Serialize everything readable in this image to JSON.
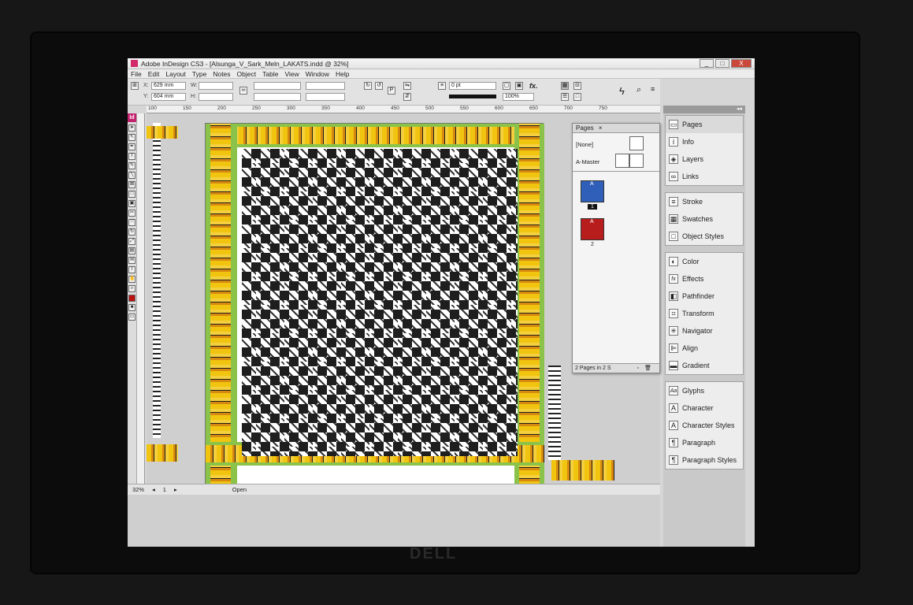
{
  "window": {
    "title": "Adobe InDesign CS3 - [Alsunga_V_Sark_Meln_LAKATS.indd @ 32%]",
    "app_icon_label": "Id",
    "min_label": "_",
    "max_label": "□",
    "close_label": "X"
  },
  "menu": [
    "File",
    "Edit",
    "Layout",
    "Type",
    "Notes",
    "Object",
    "Table",
    "View",
    "Window",
    "Help"
  ],
  "control_bar": {
    "x_label": "X:",
    "x_value": "629 mm",
    "y_label": "Y:",
    "y_value": "604 mm",
    "w_label": "W:",
    "h_label": "H:",
    "stroke_weight": "0 pt",
    "zoom": "100%",
    "fx_label": "fx."
  },
  "ruler_ticks": [
    "100",
    "150",
    "200",
    "250",
    "300",
    "350",
    "400",
    "450",
    "500",
    "550",
    "600",
    "650",
    "700",
    "750"
  ],
  "status_bar": {
    "zoom": "32%",
    "page": "1",
    "state": "Open"
  },
  "pages_panel": {
    "tab_label": "Pages",
    "close_label": "×",
    "none_master": "[None]",
    "a_master": "A-Master",
    "page1_label": "A",
    "page1_num": "1",
    "page2_label": "A",
    "page2_num": "2",
    "footer": "2 Pages in 2 S"
  },
  "dock": {
    "collapse_label": "◂◂",
    "groups": [
      [
        {
          "label": "Pages",
          "icon": "▭",
          "name": "pages"
        },
        {
          "label": "Info",
          "icon": "i",
          "name": "info"
        },
        {
          "label": "Layers",
          "icon": "◈",
          "name": "layers"
        },
        {
          "label": "Links",
          "icon": "∞",
          "name": "links"
        }
      ],
      [
        {
          "label": "Stroke",
          "icon": "≡",
          "name": "stroke"
        },
        {
          "label": "Swatches",
          "icon": "▦",
          "name": "swatches"
        },
        {
          "label": "Object Styles",
          "icon": "□",
          "name": "object-styles"
        }
      ],
      [
        {
          "label": "Color",
          "icon": "◐",
          "name": "color"
        },
        {
          "label": "Effects",
          "icon": "fx",
          "name": "effects"
        },
        {
          "label": "Pathfinder",
          "icon": "◧",
          "name": "pathfinder"
        },
        {
          "label": "Transform",
          "icon": "⌗",
          "name": "transform"
        },
        {
          "label": "Navigator",
          "icon": "✳",
          "name": "navigator"
        },
        {
          "label": "Align",
          "icon": "⊫",
          "name": "align"
        },
        {
          "label": "Gradient",
          "icon": "▬",
          "name": "gradient"
        }
      ],
      [
        {
          "label": "Glyphs",
          "icon": "Aa",
          "name": "glyphs"
        },
        {
          "label": "Character",
          "icon": "A",
          "name": "character"
        },
        {
          "label": "Character Styles",
          "icon": "A",
          "name": "character-styles"
        },
        {
          "label": "Paragraph",
          "icon": "¶",
          "name": "paragraph"
        },
        {
          "label": "Paragraph Styles",
          "icon": "¶",
          "name": "paragraph-styles"
        }
      ]
    ]
  },
  "colors": {
    "accent_id": "#c2226d",
    "border_yellow": "#f1c40f",
    "border_green": "#8bc34a",
    "page_blue": "#2f5fb8",
    "page_red": "#b81d1d"
  },
  "brand": "DELL"
}
